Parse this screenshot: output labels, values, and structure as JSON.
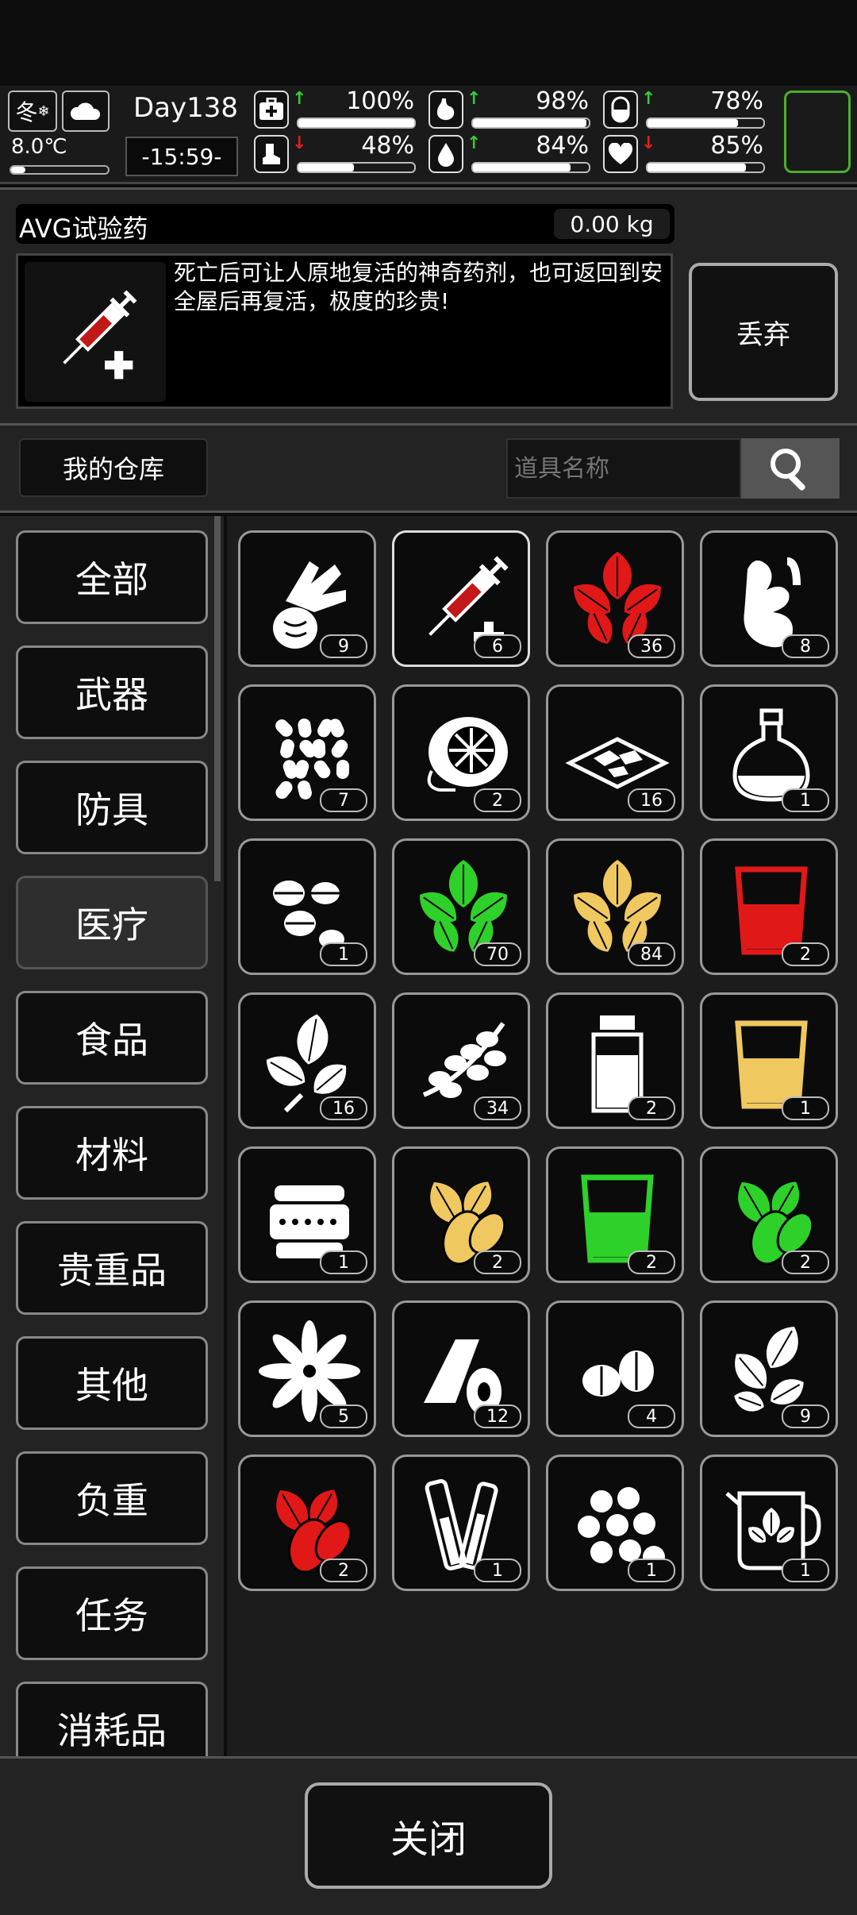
{
  "hud": {
    "season": "冬",
    "temperature": "8.0℃",
    "temperature_fill": 0.15,
    "day": "Day138",
    "time": "-15:59-",
    "stats": [
      {
        "name": "health",
        "value": "100%",
        "fill": 1.0,
        "trend": "up"
      },
      {
        "name": "hunger",
        "value": "98%",
        "fill": 0.98,
        "trend": "up"
      },
      {
        "name": "energy",
        "value": "78%",
        "fill": 0.78,
        "trend": "up"
      },
      {
        "name": "stamina",
        "value": "48%",
        "fill": 0.48,
        "trend": "down"
      },
      {
        "name": "thirst",
        "value": "84%",
        "fill": 0.84,
        "trend": "up"
      },
      {
        "name": "mood",
        "value": "85%",
        "fill": 0.85,
        "trend": "down"
      }
    ],
    "colors": {
      "up": "#33cc33",
      "down": "#e02020",
      "slot_border": "#4caf2a"
    }
  },
  "item": {
    "name": "AVG试验药",
    "weight": "0.00 kg",
    "description": "死亡后可让人原地复活的神奇药剂，也可返回到安全屋后再复活，极度的珍贵!",
    "drop_label": "丢弃"
  },
  "warehouse": {
    "tab_label": "我的仓库",
    "search_placeholder": "道具名称"
  },
  "categories": [
    "全部",
    "武器",
    "防具",
    "医疗",
    "食品",
    "材料",
    "贵重品",
    "其他",
    "负重",
    "任务",
    "消耗品"
  ],
  "active_category": "医疗",
  "items": [
    {
      "icon": "herb-bundle-icon",
      "count": "9"
    },
    {
      "icon": "syringe-icon",
      "count": "6",
      "selected": true
    },
    {
      "icon": "red-leaf-icon",
      "count": "36"
    },
    {
      "icon": "ginger-root-icon",
      "count": "8"
    },
    {
      "icon": "pills-icon",
      "count": "7"
    },
    {
      "icon": "lemon-slice-icon",
      "count": "2"
    },
    {
      "icon": "herb-tray-icon",
      "count": "16"
    },
    {
      "icon": "flask-icon",
      "count": "1"
    },
    {
      "icon": "tablets-icon",
      "count": "1"
    },
    {
      "icon": "green-leaf-icon",
      "count": "70"
    },
    {
      "icon": "yellow-leaf-icon",
      "count": "84"
    },
    {
      "icon": "red-cup-icon",
      "count": "2"
    },
    {
      "icon": "mint-leaf-icon",
      "count": "16"
    },
    {
      "icon": "berry-branch-icon",
      "count": "34"
    },
    {
      "icon": "medicine-bottle-icon",
      "count": "2"
    },
    {
      "icon": "yellow-cup-icon",
      "count": "1"
    },
    {
      "icon": "ointment-jar-icon",
      "count": "1"
    },
    {
      "icon": "yellow-seed-leaf-icon",
      "count": "2"
    },
    {
      "icon": "green-cup-icon",
      "count": "2"
    },
    {
      "icon": "green-seed-leaf-icon",
      "count": "2"
    },
    {
      "icon": "star-anise-icon",
      "count": "5"
    },
    {
      "icon": "bandage-icon",
      "count": "12"
    },
    {
      "icon": "nuts-icon",
      "count": "4"
    },
    {
      "icon": "basil-icon",
      "count": "9"
    },
    {
      "icon": "red-seed-leaf-icon",
      "count": "2"
    },
    {
      "icon": "test-tubes-icon",
      "count": "1"
    },
    {
      "icon": "seeds-icon",
      "count": "1"
    },
    {
      "icon": "herbal-tea-pot-icon",
      "count": "1"
    }
  ],
  "footer": {
    "close_label": "关闭"
  }
}
